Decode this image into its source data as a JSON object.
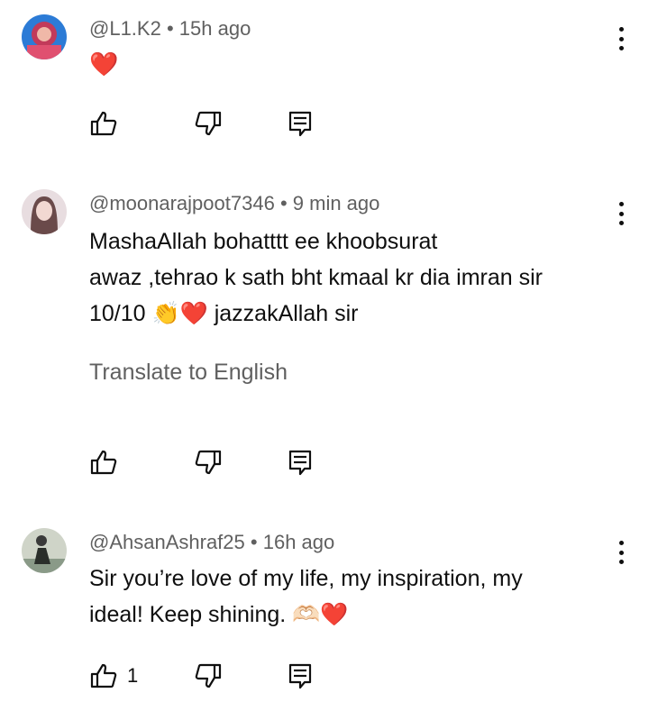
{
  "comments": [
    {
      "handle": "@L1.K2",
      "age": "15h ago",
      "text": "❤️",
      "likes": ""
    },
    {
      "handle": "@moonarajpoot7346",
      "age": "9 min ago",
      "line1": "MashaAllah bohatttt ee khoobsurat",
      "line2": "awaz ,tehrao k sath bht kmaal kr dia imran sir",
      "line3": "10/10 👏❤️ jazzakAllah sir",
      "translate": "Translate to English",
      "likes": ""
    },
    {
      "handle": "@AhsanAshraf25",
      "age": "16h ago",
      "line1": "Sir you’re love of my life, my inspiration, my",
      "line2": "ideal! Keep shining. 🫶🏻❤️",
      "likes": "1"
    }
  ],
  "separator": "•",
  "colors": {
    "heart": "#e5253b",
    "meta": "#606060",
    "text": "#0f0f0f"
  },
  "icons": [
    "thumb-up-icon",
    "thumb-down-icon",
    "reply-icon",
    "more-vert-icon"
  ]
}
